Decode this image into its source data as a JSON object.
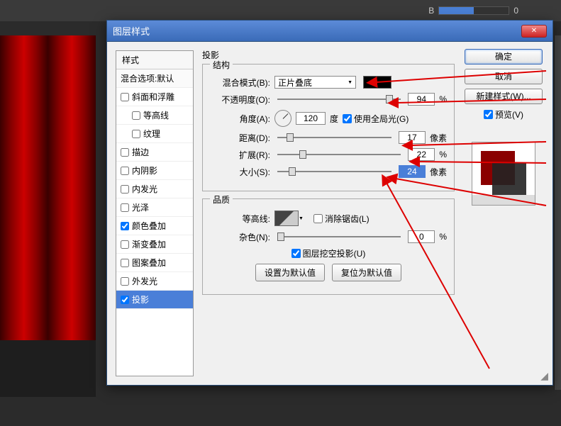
{
  "top_slider": {
    "label": "B",
    "value": "0"
  },
  "dialog_title": "图层样式",
  "styles": {
    "header": "样式",
    "default_row": "混合选项:默认",
    "items": [
      {
        "label": "斜面和浮雕",
        "checked": false
      },
      {
        "label": "等高线",
        "checked": false,
        "indent": true
      },
      {
        "label": "纹理",
        "checked": false,
        "indent": true
      },
      {
        "label": "描边",
        "checked": false
      },
      {
        "label": "内阴影",
        "checked": false
      },
      {
        "label": "内发光",
        "checked": false
      },
      {
        "label": "光泽",
        "checked": false
      },
      {
        "label": "颜色叠加",
        "checked": true
      },
      {
        "label": "渐变叠加",
        "checked": false
      },
      {
        "label": "图案叠加",
        "checked": false
      },
      {
        "label": "外发光",
        "checked": false
      },
      {
        "label": "投影",
        "checked": true,
        "selected": true
      }
    ]
  },
  "shadow": {
    "title": "投影",
    "structure_title": "结构",
    "blend_mode_label": "混合模式(B):",
    "blend_mode_value": "正片叠底",
    "opacity_label": "不透明度(O):",
    "opacity_value": "94",
    "opacity_unit": "%",
    "angle_label": "角度(A):",
    "angle_value": "120",
    "angle_unit": "度",
    "use_global_label": "使用全局光(G)",
    "distance_label": "距离(D):",
    "distance_value": "17",
    "distance_unit": "像素",
    "spread_label": "扩展(R):",
    "spread_value": "22",
    "spread_unit": "%",
    "size_label": "大小(S):",
    "size_value": "24",
    "size_unit": "像素",
    "quality_title": "品质",
    "contour_label": "等高线:",
    "antialias_label": "消除锯齿(L)",
    "noise_label": "杂色(N):",
    "noise_value": "0",
    "noise_unit": "%",
    "knockout_label": "图层挖空投影(U)",
    "make_default": "设置为默认值",
    "reset_default": "复位为默认值"
  },
  "buttons": {
    "ok": "确定",
    "cancel": "取消",
    "new_style": "新建样式(W)...",
    "preview": "预览(V)"
  }
}
